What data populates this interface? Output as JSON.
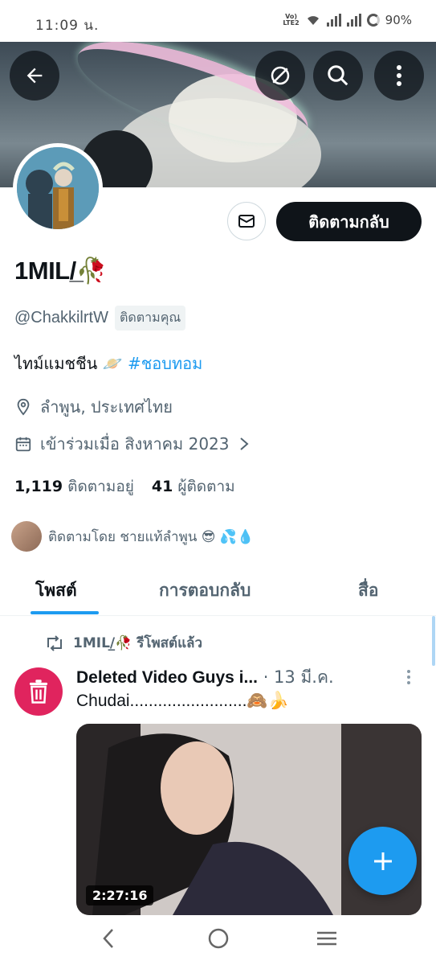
{
  "status_bar": {
    "time": "11:09 น.",
    "network_label": "Vo) LTE2",
    "battery": "90%"
  },
  "profile": {
    "display_name": "1MIL/̲🥀",
    "handle": "@ChakkilrtW",
    "follows_you_badge": "ติดตามคุณ",
    "bio_text": "ไทม์แมชชีน 🪐 ",
    "bio_hashtag": "#ชอบทอม",
    "location": "ลำพูน, ประเทศไทย",
    "joined": "เข้าร่วมเมื่อ สิงหาคม 2023",
    "following_count": "1,119",
    "following_label": "ติดตามอยู่",
    "followers_count": "41",
    "followers_label": "ผู้ติดตาม",
    "followed_by": "ติดตามโดย ชายแท้ลำพูน 😎 💦💧"
  },
  "actions": {
    "follow_back_label": "ติดตามกลับ"
  },
  "tabs": [
    {
      "label": "โพสต์"
    },
    {
      "label": "การตอบกลับ"
    },
    {
      "label": "สื่อ"
    }
  ],
  "post": {
    "repost_label": "1MIL/̲🥀 รีโพสต์แล้ว",
    "author": "Deleted Video Guys i...",
    "date": " · 13 มี.ค.",
    "text": "Chudai.........................🙈🍌",
    "video_duration": "2:27:16"
  },
  "icons": {
    "back": "arrow-left-icon",
    "hide": "eye-slash-icon",
    "search": "search-icon",
    "more": "more-vertical-icon",
    "message": "envelope-icon",
    "location": "location-pin-icon",
    "calendar": "calendar-icon",
    "repost": "repost-icon",
    "trash": "trash-icon",
    "compose": "plus-icon"
  },
  "colors": {
    "accent": "#1d9bf0",
    "primary_button": "#0f1419",
    "muted_text": "#536471",
    "trash_avatar": "#e0245e"
  }
}
